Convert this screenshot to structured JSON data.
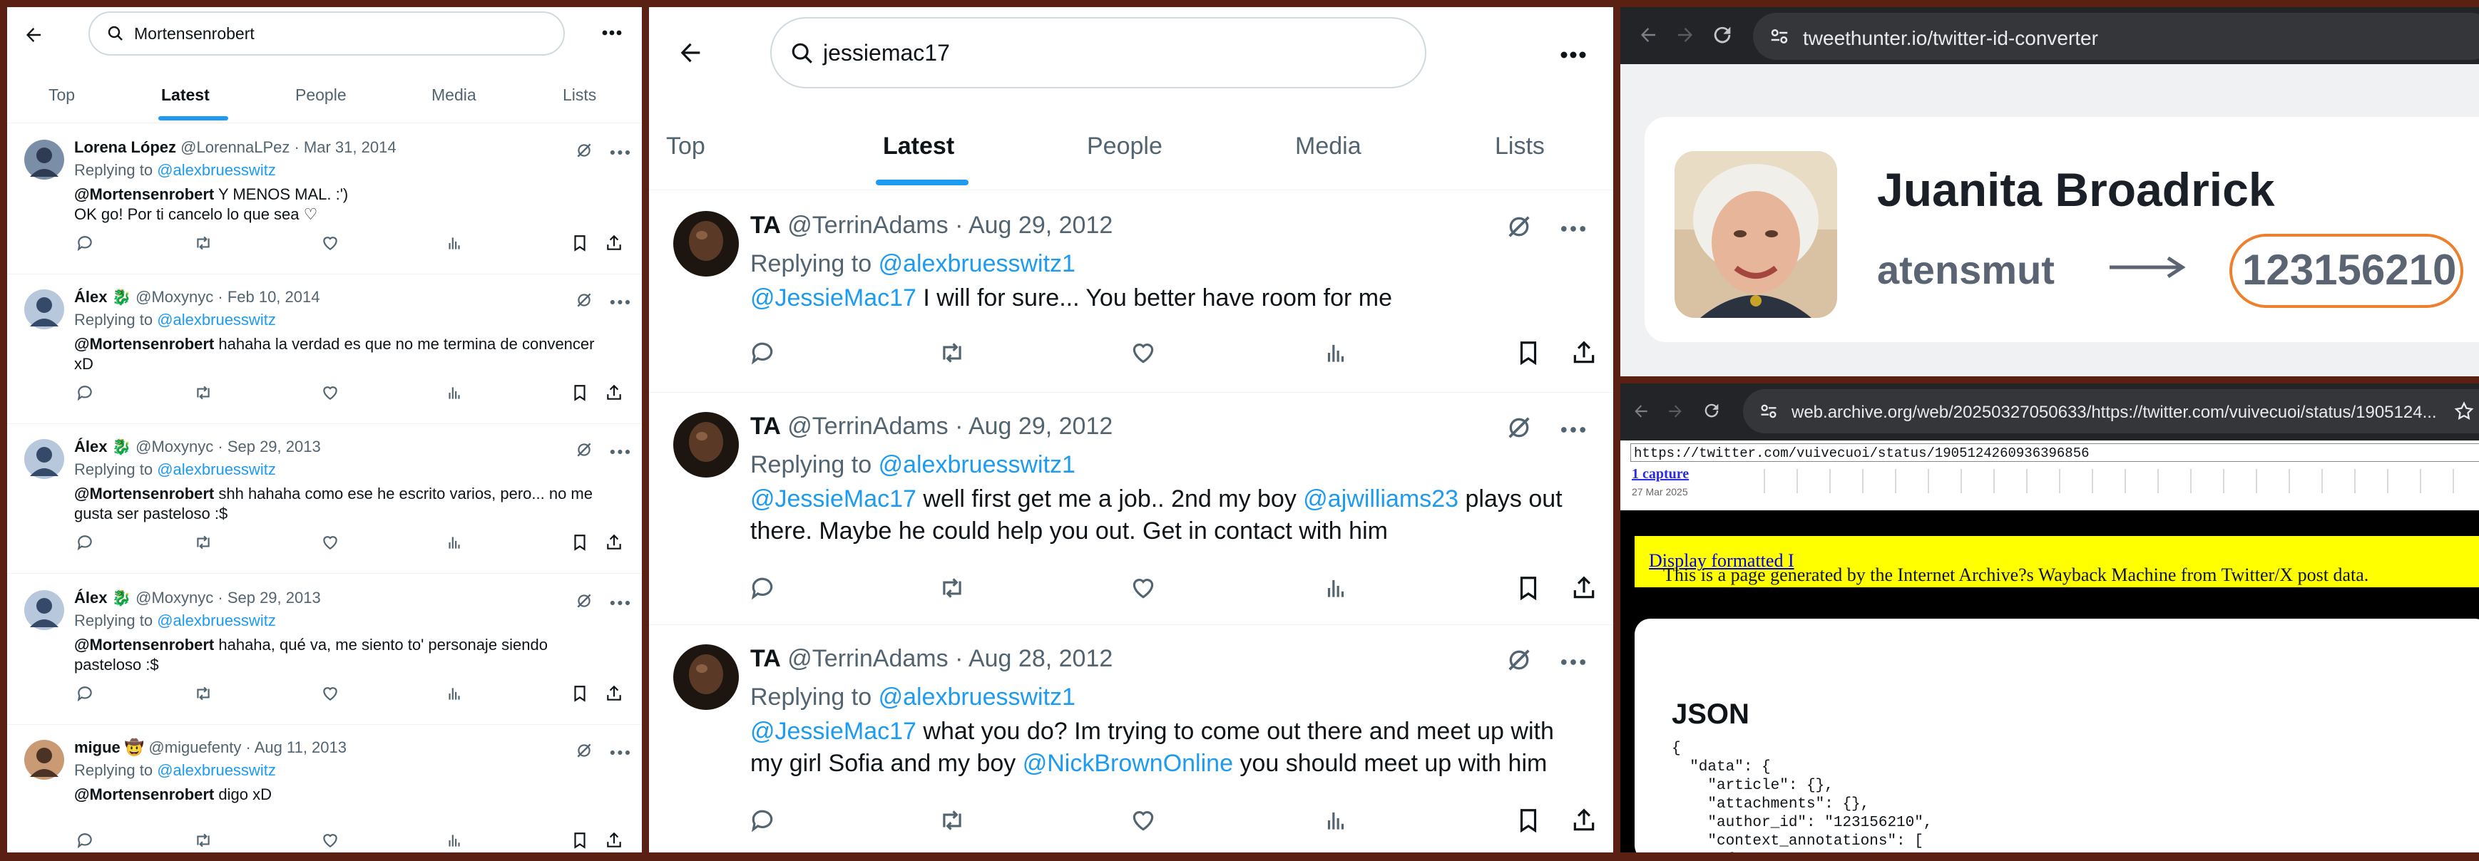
{
  "panel1": {
    "search_value": "Mortensenrobert",
    "tabs": [
      "Top",
      "Latest",
      "People",
      "Media",
      "Lists"
    ],
    "tweets": [
      {
        "name": "Lorena López",
        "handle": "@LorennaLPez",
        "date": "· Mar 31, 2014",
        "replying_label": "Replying to",
        "replying_to": "@alexbruesswitz",
        "mention": "@Mortensenrobert",
        "text1": " Y MENOS MAL. :')",
        "text2": "OK go! Por ti cancelo lo que sea ♡"
      },
      {
        "name": "Álex 🐉",
        "handle": "@Moxynyc",
        "date": "· Feb 10, 2014",
        "replying_label": "Replying to",
        "replying_to": "@alexbruesswitz",
        "mention": "@Mortensenrobert",
        "text1": " hahaha la verdad es que no me termina de convencer",
        "text2": "xD"
      },
      {
        "name": "Álex 🐉",
        "handle": "@Moxynyc",
        "date": "· Sep 29, 2013",
        "replying_label": "Replying to",
        "replying_to": "@alexbruesswitz",
        "mention": "@Mortensenrobert",
        "text1": " shh hahaha como ese he escrito varios, pero... no me",
        "text2": "gusta ser pasteloso :$"
      },
      {
        "name": "Álex 🐉",
        "handle": "@Moxynyc",
        "date": "· Sep 29, 2013",
        "replying_label": "Replying to",
        "replying_to": "@alexbruesswitz",
        "mention": "@Mortensenrobert",
        "text1": " hahaha, qué va, me siento to' personaje siendo",
        "text2": "pasteloso :$"
      },
      {
        "name": "migue 🤠",
        "handle": "@miguefenty",
        "date": "· Aug 11, 2013",
        "replying_label": "Replying to",
        "replying_to": "@alexbruesswitz",
        "mention": "@Mortensenrobert",
        "text1": " digo xD",
        "text2": ""
      }
    ]
  },
  "panel2": {
    "search_value": "jessiemac17",
    "tabs": [
      "Top",
      "Latest",
      "People",
      "Media",
      "Lists"
    ],
    "tweets": [
      {
        "name": "TA",
        "handle": "@TerrinAdams",
        "date": "· Aug 29, 2012",
        "replying_label": "Replying to",
        "replying_to": "@alexbruesswitz1",
        "mention": "@JessieMac17",
        "text_a": " I will for sure... You better have room for me",
        "mention2": "",
        "text_b": "",
        "mention3": "",
        "text_c": ""
      },
      {
        "name": "TA",
        "handle": "@TerrinAdams",
        "date": "· Aug 29, 2012",
        "replying_label": "Replying to",
        "replying_to": "@alexbruesswitz1",
        "mention": "@JessieMac17",
        "text_a": " well first get me a job.. 2nd my boy ",
        "mention2": " @ajwilliams23",
        "text_b": " plays out there. Maybe he could help you out. Get in contact with him",
        "mention3": "",
        "text_c": ""
      },
      {
        "name": "TA",
        "handle": "@TerrinAdams",
        "date": "· Aug 28, 2012",
        "replying_label": "Replying to",
        "replying_to": "@alexbruesswitz1",
        "mention": "@JessieMac17",
        "text_a": " what you do? Im trying to come out there and meet up with my girl Sofia and my boy ",
        "mention2": "@NickBrownOnline",
        "text_b": " you should meet up with him",
        "mention3": "",
        "text_c": ""
      }
    ]
  },
  "panel3": {
    "url": "tweethunter.io/twitter-id-converter",
    "name": "Juanita Broadrick",
    "handle": "atensmut",
    "user_id": "123156210",
    "highlight_color": "#ee7f2d"
  },
  "panel4": {
    "url": "web.archive.org/web/20250327050633/https://twitter.com/vuivecuoi/status/1905124...",
    "wayback_input": "https://twitter.com/vuivecuoi/status/1905124260936396856",
    "captures": "1 capture",
    "capture_date": "27 Mar 2025",
    "notice": "This is a page generated by the Internet Archive?s Wayback Machine from Twitter/X post data.",
    "notice_link": "Display formatted I",
    "json_heading": "JSON",
    "json_lines": [
      "{",
      "  \"data\": {",
      "    \"article\": {},",
      "    \"attachments\": {},",
      "    \"author_id\": \"123156210\",",
      "    \"context_annotations\": [",
      "      {"
    ]
  }
}
